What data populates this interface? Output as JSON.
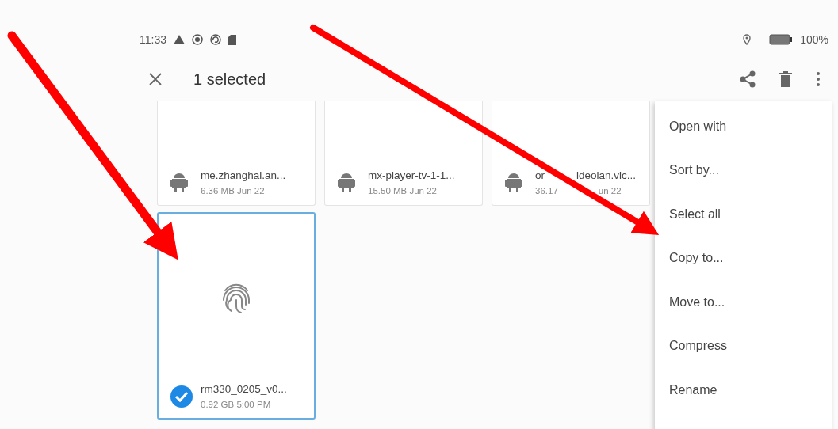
{
  "status_bar": {
    "time": "11:33",
    "battery": "100%"
  },
  "app_bar": {
    "title": "1 selected"
  },
  "files": [
    {
      "name": "me.zhanghai.an...",
      "meta": "6.36 MB  Jun 22",
      "kind": "apk",
      "selected": false
    },
    {
      "name": "mx-player-tv-1-1...",
      "meta": "15.50 MB  Jun 22",
      "kind": "apk",
      "selected": false
    },
    {
      "name": "or",
      "name_rest": "ideolan.vlc...",
      "meta": "36.17",
      "meta_rest": "un 22",
      "kind": "apk",
      "selected": false
    },
    {
      "name": "rm330_0205_v0...",
      "meta": "0.92 GB  5:00 PM",
      "kind": "fingerprint",
      "selected": true
    }
  ],
  "menu": [
    "Open with",
    "Sort by...",
    "Select all",
    "Copy to...",
    "Move to...",
    "Compress",
    "Rename"
  ],
  "annotations": [
    {
      "kind": "arrow"
    },
    {
      "kind": "arrow"
    }
  ]
}
